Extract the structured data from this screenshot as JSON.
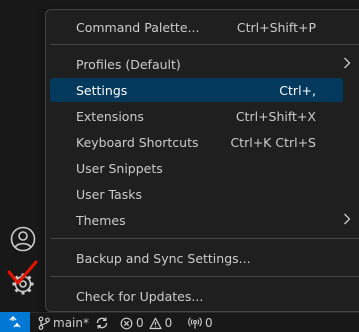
{
  "menu": {
    "items": [
      {
        "label": "Command Palette...",
        "keybinding": "Ctrl+Shift+P"
      },
      {
        "label": "Profiles (Default)",
        "submenu": true
      },
      {
        "label": "Settings",
        "keybinding": "Ctrl+,",
        "selected": true
      },
      {
        "label": "Extensions",
        "keybinding": "Ctrl+Shift+X"
      },
      {
        "label": "Keyboard Shortcuts",
        "keybinding": "Ctrl+K Ctrl+S"
      },
      {
        "label": "User Snippets"
      },
      {
        "label": "User Tasks"
      },
      {
        "label": "Themes",
        "submenu": true
      },
      {
        "label": "Backup and Sync Settings..."
      },
      {
        "label": "Check for Updates..."
      }
    ]
  },
  "status_bar": {
    "branch": "main*",
    "errors": "0",
    "warnings": "0",
    "ports": "0"
  },
  "icons": {
    "account": "account-icon",
    "manage": "gear-icon",
    "annotation": "red-checkmark",
    "remote": "remote-icon",
    "branch": "git-branch-icon",
    "sync": "sync-icon",
    "error": "error-icon",
    "warning": "warning-icon",
    "ports": "broadcast-icon"
  },
  "colors": {
    "selected_bg": "#04395e",
    "remote_bg": "#0078d4",
    "annotation": "#e51400"
  }
}
